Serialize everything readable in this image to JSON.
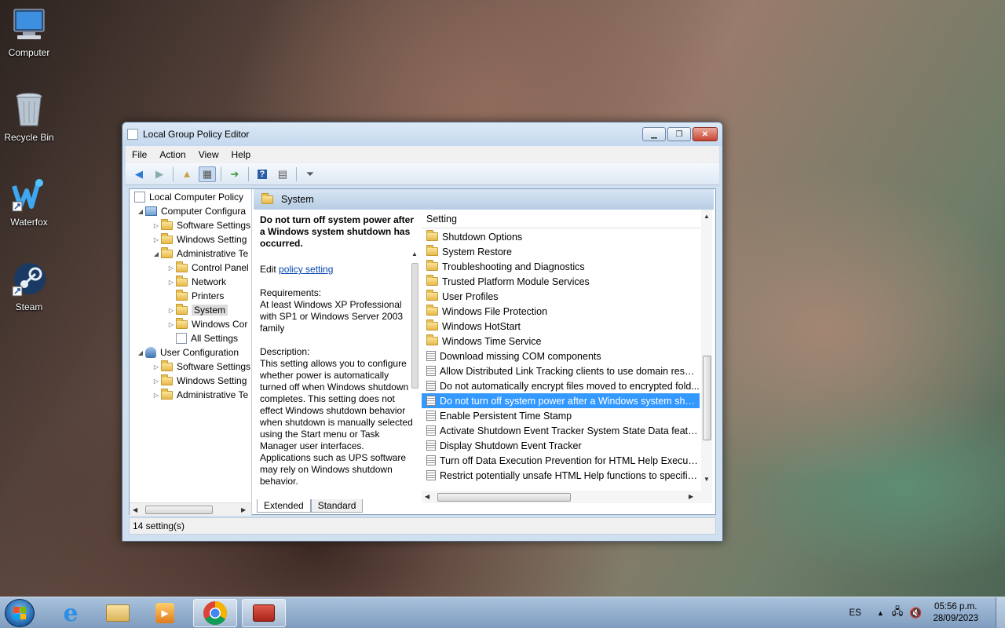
{
  "desktop": {
    "icons": [
      {
        "label": "Computer"
      },
      {
        "label": "Recycle Bin"
      },
      {
        "label": "Waterfox"
      },
      {
        "label": "Steam"
      }
    ]
  },
  "window": {
    "title": "Local Group Policy Editor",
    "menu": [
      "File",
      "Action",
      "View",
      "Help"
    ],
    "tree": {
      "root": "Local Computer Policy",
      "computer_config": "Computer Configura",
      "software_settings": "Software Settings",
      "windows_settings": "Windows Setting",
      "admin_templates": "Administrative Te",
      "control_panel": "Control Panel",
      "network": "Network",
      "printers": "Printers",
      "system": "System",
      "windows_components": "Windows Cor",
      "all_settings": "All Settings",
      "user_config": "User Configuration",
      "user_software_settings": "Software Settings",
      "user_windows_settings": "Windows Setting",
      "user_admin_templates": "Administrative Te"
    },
    "header_title": "System",
    "description": {
      "heading": "Do not turn off system power after a Windows system shutdown has occurred.",
      "edit_prefix": "Edit ",
      "edit_link": "policy setting",
      "requirements_label": "Requirements:",
      "requirements_text": "At least Windows XP Professional with SP1 or Windows Server 2003 family",
      "description_label": "Description:",
      "description_text": "This setting allows you to configure whether power is automatically turned off when Windows shutdown completes. This setting does not effect Windows shutdown behavior when shutdown is manually selected using the Start menu or Task Manager user interfaces. Applications such as UPS software may rely on Windows shutdown behavior."
    },
    "list_header": "Setting",
    "list_rows": [
      {
        "kind": "folder",
        "label": "Shutdown Options"
      },
      {
        "kind": "folder",
        "label": "System Restore"
      },
      {
        "kind": "folder",
        "label": "Troubleshooting and Diagnostics"
      },
      {
        "kind": "folder",
        "label": "Trusted Platform Module Services"
      },
      {
        "kind": "folder",
        "label": "User Profiles"
      },
      {
        "kind": "folder",
        "label": "Windows File Protection"
      },
      {
        "kind": "folder",
        "label": "Windows HotStart"
      },
      {
        "kind": "folder",
        "label": "Windows Time Service"
      },
      {
        "kind": "setting",
        "label": "Download missing COM components"
      },
      {
        "kind": "setting",
        "label": "Allow Distributed Link Tracking clients to use domain resour..."
      },
      {
        "kind": "setting",
        "label": "Do not automatically encrypt files moved to encrypted fold..."
      },
      {
        "kind": "setting",
        "label": "Do not turn off system power after a Windows system shutd...",
        "selected": true
      },
      {
        "kind": "setting",
        "label": "Enable Persistent Time Stamp"
      },
      {
        "kind": "setting",
        "label": "Activate Shutdown Event Tracker System State Data feature"
      },
      {
        "kind": "setting",
        "label": "Display Shutdown Event Tracker"
      },
      {
        "kind": "setting",
        "label": "Turn off Data Execution Prevention for HTML Help Executible"
      },
      {
        "kind": "setting",
        "label": "Restrict potentially unsafe HTML Help functions to specified..."
      }
    ],
    "tabs": [
      "Extended",
      "Standard"
    ],
    "status": "14 setting(s)"
  },
  "taskbar": {
    "language": "ES",
    "time": "05:56 p.m.",
    "date": "28/09/2023"
  },
  "colors": {
    "selection": "#3399ff",
    "link": "#0645ad"
  }
}
